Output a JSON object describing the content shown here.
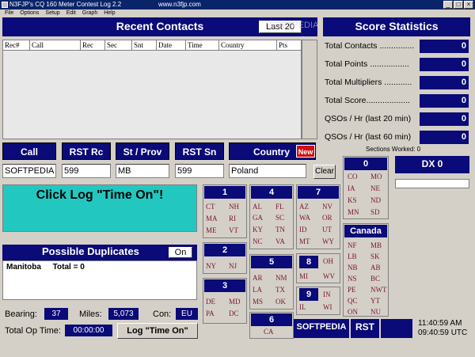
{
  "window": {
    "title": "N3FJP's CQ 160 Meter Contest Log 2.2",
    "url_text": "www.n3fjp.com"
  },
  "menu": [
    "File",
    "Options",
    "Setup",
    "Edit",
    "Graph",
    "Help"
  ],
  "recent": {
    "title": "Recent Contacts",
    "last_button": "Last 20",
    "columns": [
      "Rec#",
      "Call",
      "Rec",
      "Sec",
      "Snt",
      "Date",
      "Time",
      "Country",
      "Pts"
    ],
    "watermark": "SOFTPEDIA"
  },
  "stats": {
    "title": "Score Statistics",
    "rows": [
      {
        "label": "Total Contacts ...............",
        "value": "0"
      },
      {
        "label": "Total Points .................",
        "value": "0"
      },
      {
        "label": "Total Multipliers ............",
        "value": "0"
      },
      {
        "label": "Total Score...................",
        "value": "0"
      },
      {
        "label": "QSOs / Hr (last 20 min)",
        "value": "0"
      },
      {
        "label": "QSOs / Hr (last 60 min)",
        "value": "0"
      }
    ],
    "sections_worked": "Sections Worked: 0"
  },
  "fields": {
    "call_label": "Call",
    "call_value": "SOFTPEDIA",
    "rst_rc_label": "RST Rc",
    "rst_rc_value": "599",
    "st_prov_label": "St / Prov",
    "st_prov_value": "MB",
    "rst_sn_label": "RST Sn",
    "rst_sn_value": "599",
    "country_label": "Country",
    "new_badge": "New",
    "country_value": "Poland",
    "clear_button": "Clear"
  },
  "status_message": "Click Log \"Time On\"!",
  "duplicates": {
    "title": "Possible Duplicates",
    "toggle": "On",
    "line1": "Manitoba",
    "line2": "Total = 0"
  },
  "bottom": {
    "bearing_label": "Bearing:",
    "bearing_value": "37",
    "miles_label": "Miles:",
    "miles_value": "5,073",
    "con_label": "Con:",
    "con_value": "EU",
    "op_time_label": "Total Op Time:",
    "op_time_value": "00:00:00",
    "log_button": "Log \"Time On\""
  },
  "districts": [
    {
      "num": "1",
      "sections": [
        "CT",
        "NH",
        "MA",
        "RI",
        "ME",
        "VT"
      ]
    },
    {
      "num": "2",
      "sections": [
        "NY",
        "NJ"
      ]
    },
    {
      "num": "3",
      "sections": [
        "DE",
        "MD",
        "PA",
        "DC"
      ]
    },
    {
      "num": "4",
      "sections": [
        "AL",
        "FL",
        "GA",
        "SC",
        "KY",
        "TN",
        "NC",
        "VA"
      ]
    },
    {
      "num": "5",
      "sections": [
        "AR",
        "NM",
        "LA",
        "TX",
        "MS",
        "OK"
      ]
    },
    {
      "num": "6",
      "sections": [
        "CA"
      ]
    },
    {
      "num": "7",
      "sections": [
        "AZ",
        "NV",
        "WA",
        "OR",
        "ID",
        "UT",
        "MT",
        "WY"
      ]
    },
    {
      "num": "8",
      "sections": [
        "OH",
        "MI",
        "WV"
      ]
    },
    {
      "num": "9",
      "sections": [
        "IN",
        "IL",
        "WI"
      ]
    },
    {
      "num": "0",
      "sections": [
        "CO",
        "MO",
        "IA",
        "NE",
        "KS",
        "ND",
        "MN",
        "SD"
      ]
    }
  ],
  "canada": {
    "title": "Canada",
    "sections": [
      "NF",
      "MB",
      "LB",
      "SK",
      "NB",
      "AB",
      "NS",
      "BC",
      "PE",
      "NWT",
      "QC",
      "YT",
      "ON",
      "NU"
    ]
  },
  "dx": {
    "title": "DX  0"
  },
  "status_strip": {
    "call": "SOFTPEDIA",
    "rst": "RST",
    "time_local": "11:40:59 AM",
    "time_utc": "09:40:59 UTC"
  }
}
